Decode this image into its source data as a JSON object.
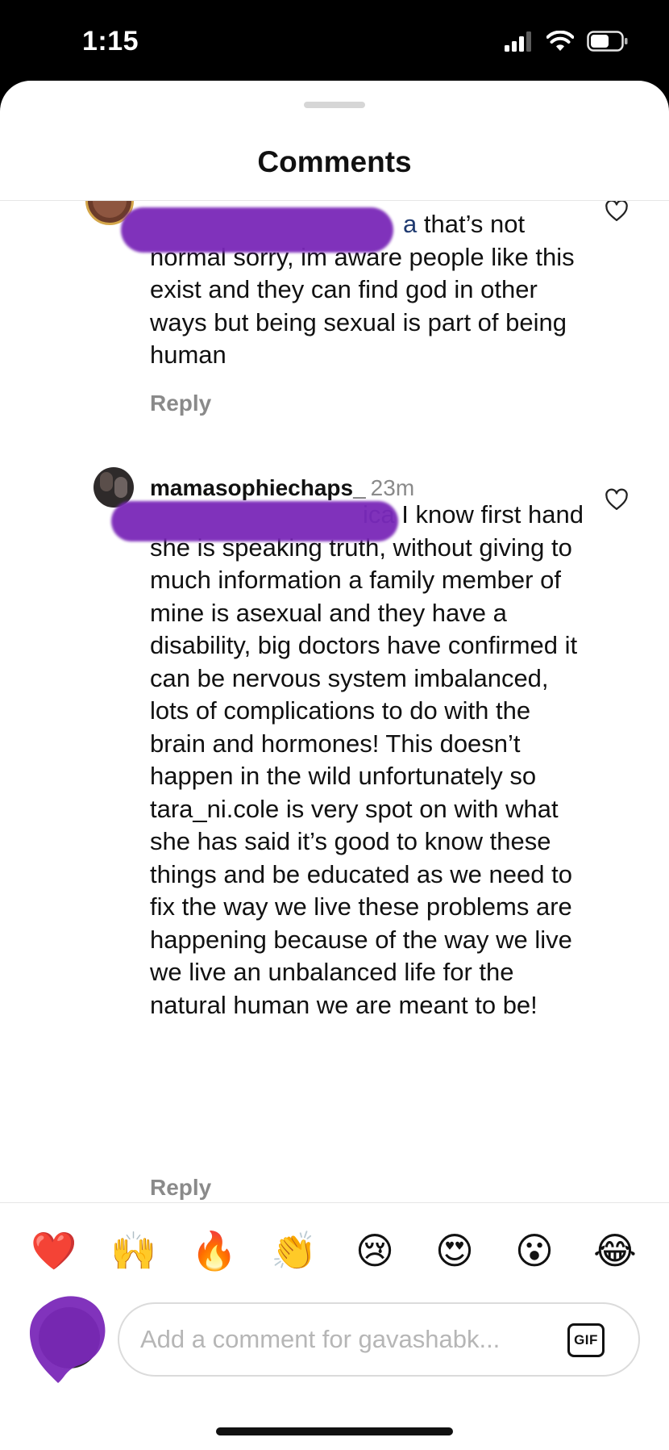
{
  "status_bar": {
    "time": "1:15"
  },
  "sheet": {
    "title": "Comments"
  },
  "comments": [
    {
      "mention_tail": "a",
      "text": " that’s not normal sorry, im aware people like this exist and they can find god in other ways but being sexual is part of being human",
      "reply_label": "Reply"
    },
    {
      "username": "mamasophiechaps_",
      "time_ago": "23m",
      "mention_tail": "ica",
      "text": " I know first hand she is speaking truth, without giving to much information a family member of mine is asexual and they have a disability, big doctors have confirmed it can be nervous system imbalanced, lots of complications to do with the brain and hormones! This doesn’t happen in the wild unfortunately so tara_ni.cole is very spot on with what she has said it’s good to know these things and be educated as we need to fix the way we live these problems are happening because of the way we live we live an unbalanced life for the natural human we are meant to be!",
      "reply_label": "Reply"
    }
  ],
  "emoji_bar": [
    {
      "name": "red-heart",
      "glyph": "❤️"
    },
    {
      "name": "raising-hands",
      "glyph": "🙌"
    },
    {
      "name": "fire",
      "glyph": "🔥"
    },
    {
      "name": "clapping-hands",
      "glyph": "👏"
    },
    {
      "name": "crying-face",
      "glyph": "😢"
    },
    {
      "name": "heart-eyes",
      "glyph": "😍"
    },
    {
      "name": "surprised-face",
      "glyph": "😮"
    },
    {
      "name": "tears-of-joy",
      "glyph": "😂"
    }
  ],
  "composer": {
    "placeholder": "Add a comment for gavashabk...",
    "gif_label": "GIF"
  },
  "colors": {
    "redaction": "#7a28b8",
    "secondary_text": "#8a8a8a",
    "mention": "#1f3a70"
  }
}
